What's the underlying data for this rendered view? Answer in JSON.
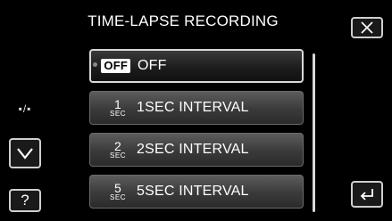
{
  "header": {
    "title": "TIME-LAPSE RECORDING"
  },
  "left_panel": {
    "mode_toggle": "▪/▪",
    "help_label": "?"
  },
  "options": [
    {
      "icon_text": "OFF",
      "label": "OFF",
      "selected": true
    },
    {
      "icon_num": "1",
      "icon_unit": "SEC",
      "label": "1SEC INTERVAL"
    },
    {
      "icon_num": "2",
      "icon_unit": "SEC",
      "label": "2SEC INTERVAL"
    },
    {
      "icon_num": "5",
      "icon_unit": "SEC",
      "label": "5SEC INTERVAL"
    }
  ]
}
